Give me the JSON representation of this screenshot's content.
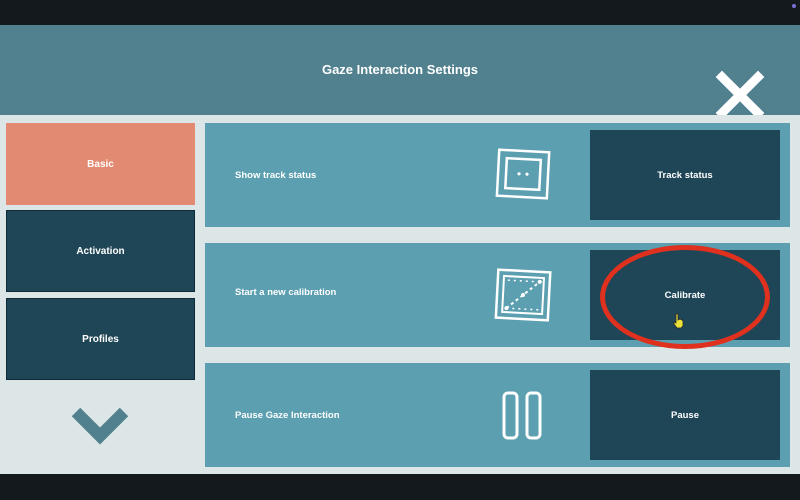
{
  "window": {
    "title": "Gaze Interaction Settings"
  },
  "header": {
    "title": "Gaze Interaction Settings",
    "close_icon": "close-x-icon"
  },
  "sidebar": {
    "items": [
      {
        "label": "Basic",
        "state": "selected"
      },
      {
        "label": "Activation",
        "state": "normal"
      },
      {
        "label": "Profiles",
        "state": "normal"
      }
    ],
    "scroll_icon": "chevron-down-icon"
  },
  "rows": [
    {
      "label": "Show track status",
      "icon": "track-status-icon",
      "button": "Track status"
    },
    {
      "label": "Start a new calibration",
      "icon": "calibration-icon",
      "button": "Calibrate"
    },
    {
      "label": "Pause Gaze Interaction",
      "icon": "pause-icon",
      "button": "Pause"
    }
  ],
  "colors": {
    "header": "#51818f",
    "content_bg": "#dde6e6",
    "selected": "#e38b72",
    "dark_button": "#1f4656",
    "row_bg": "#5b9fb0",
    "highlight": "#e0301e"
  }
}
